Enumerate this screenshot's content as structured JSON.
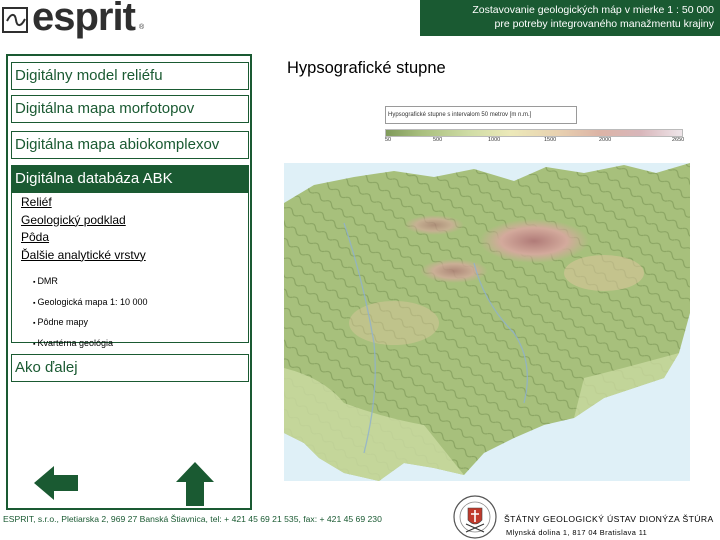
{
  "header": {
    "logo_text": "esprit",
    "logo_registered": "®",
    "title_line1": "Zostavovanie geologických máp v mierke 1 : 50 000",
    "title_line2": "pre potreby integrovaného manažmentu krajiny"
  },
  "sidebar": {
    "menu": [
      {
        "label": "Digitálny model reliéfu"
      },
      {
        "label": "Digitálna mapa morfotopov"
      },
      {
        "label": "Digitálna mapa abiokomplexov"
      }
    ],
    "active": {
      "label": "Digitálna databáza ABK",
      "links": [
        {
          "label": "Reliéf"
        },
        {
          "label": "Geologický podklad"
        },
        {
          "label": "Pôda"
        },
        {
          "label": "Ďalšie analytické vrstvy"
        }
      ],
      "bullets": [
        {
          "label": "DMR"
        },
        {
          "label": "Geologická mapa 1: 10 000"
        },
        {
          "label": "Pôdne mapy"
        },
        {
          "label": "Kvartérna geológia"
        }
      ]
    },
    "last_menu": {
      "label": "Ako ďalej"
    }
  },
  "main": {
    "title": "Hypsografické stupne",
    "legend": {
      "title": "Hypsografické stupne s intervalom 50 metrov [m n.m.]",
      "ticks": [
        "50",
        "500",
        "1000",
        "1500",
        "2000",
        "2650"
      ]
    }
  },
  "nav": {
    "back_icon": "arrow-left-icon",
    "up_icon": "arrow-up-icon",
    "color": "#1a5a32"
  },
  "footer": {
    "address": "ESPRIT, s.r.o., Pletiarska 2, 969 27 Banská Štiavnica, tel: + 421 45 69 21 535, fax: + 421 45 69 230",
    "org": "ŠTÁTNY GEOLOGICKÝ ÚSTAV DIONÝZA ŠTÚRA",
    "org_address": "Mlynská dolina 1, 817 04 Bratislava 11"
  },
  "colors": {
    "accent": "#1a5a32",
    "map_lowland": "#a7c07c",
    "map_highland": "#c38f88"
  }
}
